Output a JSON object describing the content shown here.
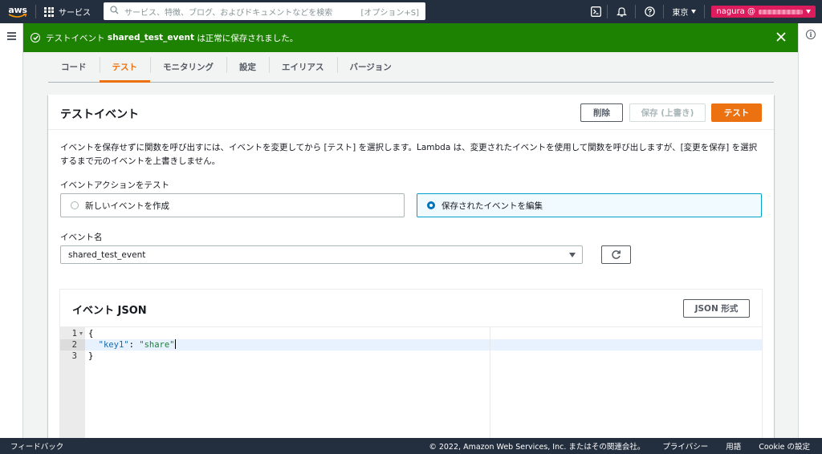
{
  "topnav": {
    "logo_text": "aws",
    "services_label": "サービス",
    "search_placeholder": "サービス、特徴、ブログ、およびドキュメントなどを検索",
    "search_shortcut": "[オプション+S]",
    "region_label": "東京",
    "account_label": "nagura @"
  },
  "flash": {
    "prefix": "テストイベント",
    "event_name": "shared_test_event",
    "suffix": "は正常に保存されました。"
  },
  "tabs": [
    {
      "label": "コード"
    },
    {
      "label": "テスト"
    },
    {
      "label": "モニタリング"
    },
    {
      "label": "設定"
    },
    {
      "label": "エイリアス"
    },
    {
      "label": "バージョン"
    }
  ],
  "panel": {
    "title": "テストイベント",
    "delete_label": "削除",
    "save_label": "保存 (上書き)",
    "test_label": "テスト",
    "description": "イベントを保存せずに関数を呼び出すには、イベントを変更してから [テスト] を選択します。Lambda は、変更されたイベントを使用して関数を呼び出しますが、[変更を保存] を選択するまで元のイベントを上書きしません。",
    "action_label": "イベントアクションをテスト",
    "option_new": "新しいイベントを作成",
    "option_edit": "保存されたイベントを編集",
    "event_name_label": "イベント名",
    "event_name_value": "shared_test_event"
  },
  "json_panel": {
    "title": "イベント JSON",
    "format_button": "JSON 形式",
    "lines": [
      {
        "num": "1",
        "text": "{"
      },
      {
        "num": "2",
        "key": "\"key1\"",
        "sep": ": ",
        "value": "\"share\""
      },
      {
        "num": "3",
        "text": "}"
      }
    ]
  },
  "footer": {
    "feedback": "フィードバック",
    "copyright": "© 2022, Amazon Web Services, Inc. またはその関連会社。",
    "privacy": "プライバシー",
    "terms": "用語",
    "cookie": "Cookie の設定"
  }
}
